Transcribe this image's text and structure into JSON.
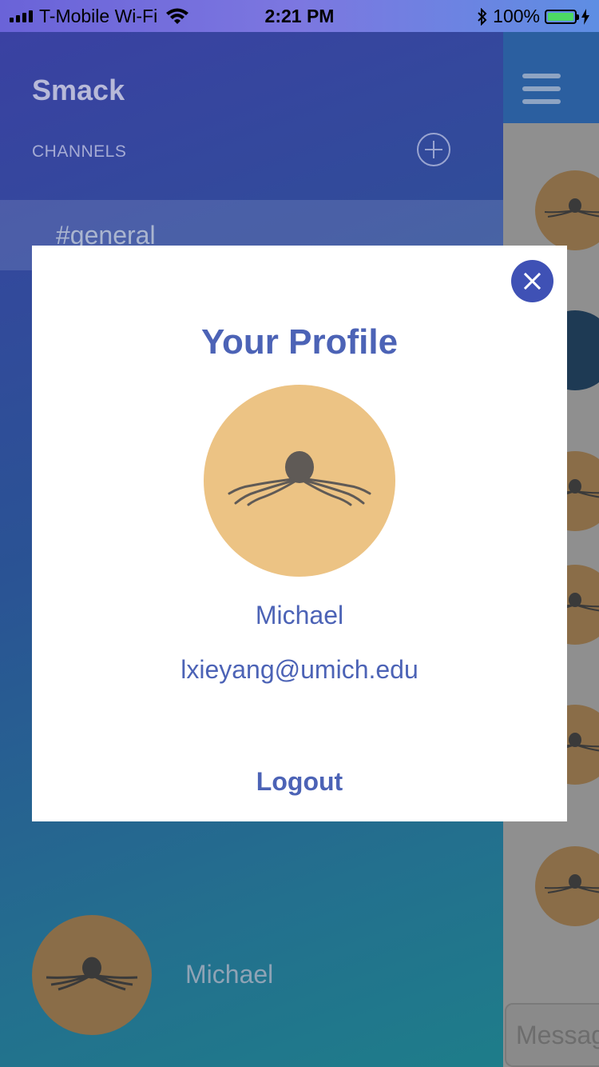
{
  "status_bar": {
    "carrier": "T-Mobile Wi-Fi",
    "time": "2:21 PM",
    "battery": "100%"
  },
  "sidebar": {
    "app_title": "Smack",
    "channels_label": "CHANNELS",
    "channels": [
      {
        "name": "#general"
      }
    ],
    "user": {
      "name": "Michael"
    }
  },
  "chat": {
    "message_placeholder": "Message"
  },
  "profile_modal": {
    "title": "Your Profile",
    "name": "Michael",
    "email": "lxieyang@umich.edu",
    "logout_label": "Logout"
  },
  "colors": {
    "accent": "#4c63b6",
    "close_button": "#3f51b5",
    "avatar_background": "#ecc384"
  }
}
